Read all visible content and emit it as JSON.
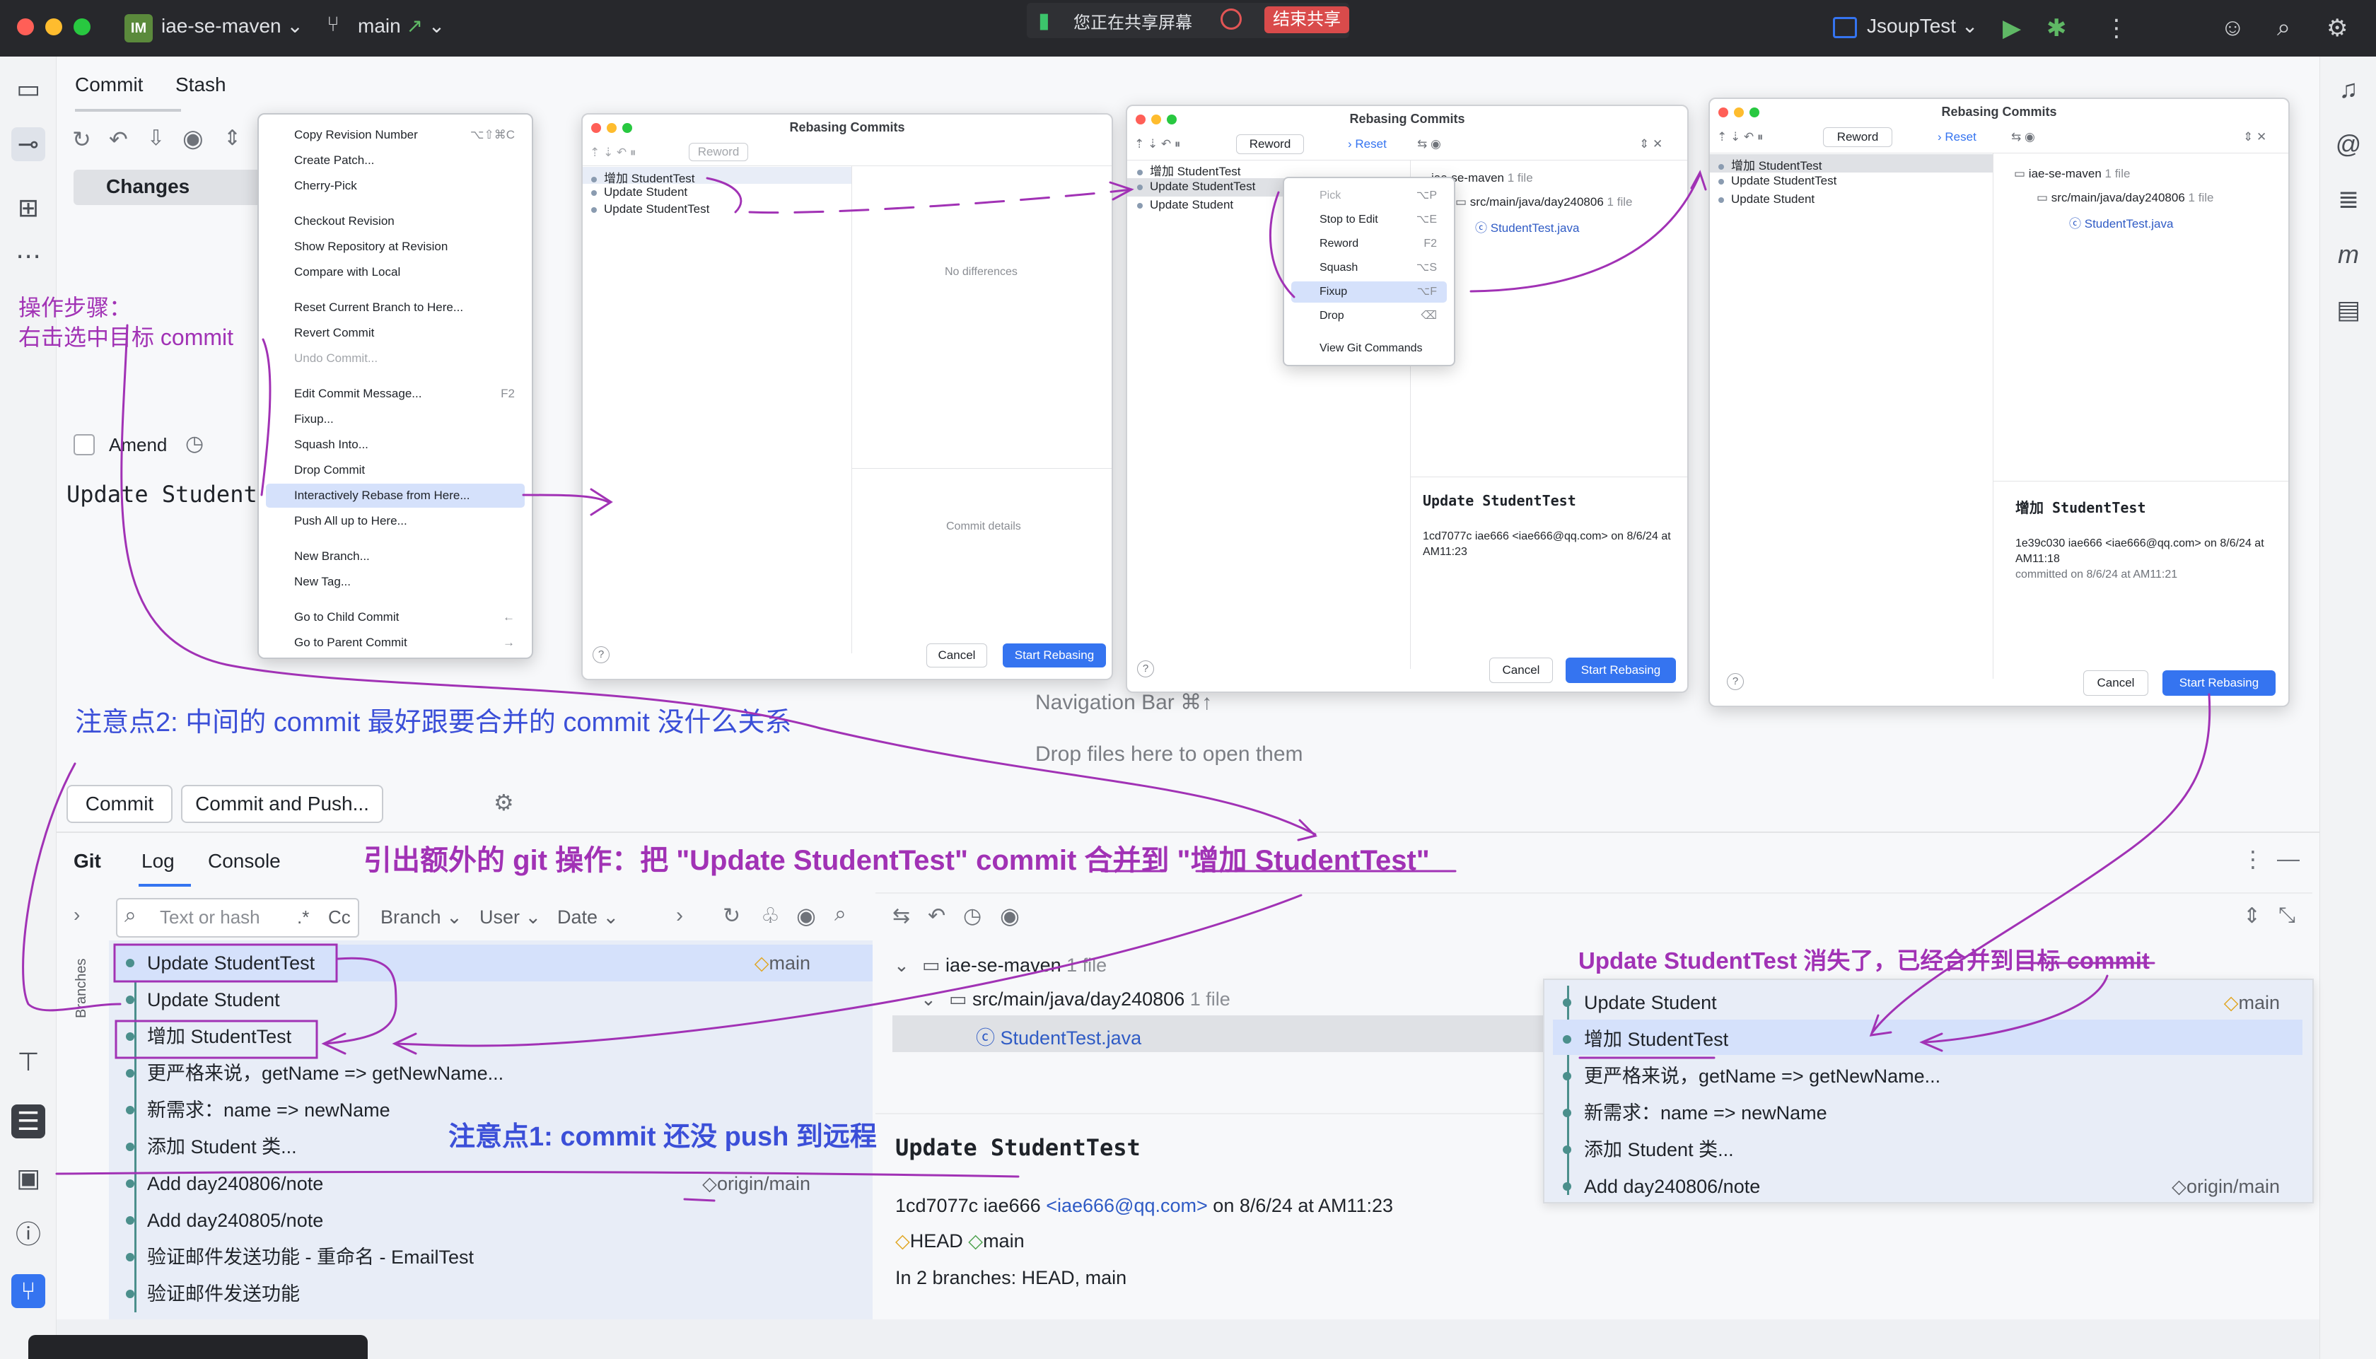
{
  "titlebar": {
    "project_badge": "IM",
    "project": "iae-se-maven",
    "branch": "main",
    "sharing_text": "您正在共享屏幕",
    "end_share": "结束共享",
    "run_config": "JsoupTest"
  },
  "commit_panel": {
    "tab_commit": "Commit",
    "tab_stash": "Stash",
    "changes_label": "Changes",
    "amend_label": "Amend",
    "message": "Update Student",
    "commit_button": "Commit",
    "commit_push_button": "Commit and Push..."
  },
  "editor_empty": {
    "nav_bar_hint": "Navigation Bar ⌘↑",
    "drop_hint": "Drop files here to open them"
  },
  "bottom_tabs": {
    "git": "Git",
    "log": "Log",
    "console": "Console"
  },
  "log_toolbar": {
    "search_placeholder": "Text or hash",
    "regex": ".*",
    "case": "Cc",
    "branch": "Branch",
    "user": "User",
    "date": "Date",
    "branches_side": "Branches"
  },
  "log_rows": [
    {
      "message": "Update StudentTest",
      "tag": "main"
    },
    {
      "message": "Update Student",
      "tag": ""
    },
    {
      "message": "增加 StudentTest",
      "tag": ""
    },
    {
      "message": "更严格来说，getName => getNewName...",
      "tag": ""
    },
    {
      "message": "新需求：name => newName",
      "tag": ""
    },
    {
      "message": "添加 Student 类...",
      "tag": ""
    },
    {
      "message": "Add day240806/note",
      "tag": "origin/main"
    },
    {
      "message": "Add day240805/note",
      "tag": ""
    },
    {
      "message": "验证邮件发送功能 - 重命名 - EmailTest",
      "tag": ""
    },
    {
      "message": "验证邮件发送功能",
      "tag": ""
    }
  ],
  "changes_tree": {
    "root": "iae-se-maven",
    "root_count": "1 file",
    "folder": "src/main/java/day240806",
    "folder_count": "1 file",
    "file": "StudentTest.java"
  },
  "commit_details": {
    "title": "Update StudentTest",
    "hash_author": "1cd7077c iae666",
    "email": "<iae666@qq.com>",
    "date": "on 8/6/24 at AM11:23",
    "ref_head": "HEAD",
    "ref_main": "main",
    "branches": "In 2 branches: HEAD, main"
  },
  "context_menu": [
    {
      "label": "Copy Revision Number",
      "shortcut": "⌥⇧⌘C",
      "disabled": false
    },
    {
      "label": "Create Patch...",
      "shortcut": "",
      "disabled": false
    },
    {
      "label": "Cherry-Pick",
      "shortcut": "",
      "disabled": false
    },
    {
      "label": "Checkout Revision",
      "shortcut": "",
      "disabled": false
    },
    {
      "label": "Show Repository at Revision",
      "shortcut": "",
      "disabled": false
    },
    {
      "label": "Compare with Local",
      "shortcut": "",
      "disabled": false
    },
    {
      "label": "Reset Current Branch to Here...",
      "shortcut": "",
      "disabled": false
    },
    {
      "label": "Revert Commit",
      "shortcut": "",
      "disabled": false
    },
    {
      "label": "Undo Commit...",
      "shortcut": "",
      "disabled": true
    },
    {
      "label": "Edit Commit Message...",
      "shortcut": "F2",
      "disabled": false
    },
    {
      "label": "Fixup...",
      "shortcut": "",
      "disabled": false
    },
    {
      "label": "Squash Into...",
      "shortcut": "",
      "disabled": false
    },
    {
      "label": "Drop Commit",
      "shortcut": "",
      "disabled": false
    },
    {
      "label": "Interactively Rebase from Here...",
      "shortcut": "",
      "disabled": false,
      "selected": true
    },
    {
      "label": "Push All up to Here...",
      "shortcut": "",
      "disabled": false
    },
    {
      "label": "New Branch...",
      "shortcut": "",
      "disabled": false
    },
    {
      "label": "New Tag...",
      "shortcut": "",
      "disabled": false
    },
    {
      "label": "Go to Child Commit",
      "shortcut": "←",
      "disabled": false
    },
    {
      "label": "Go to Parent Commit",
      "shortcut": "→",
      "disabled": false
    }
  ],
  "rebase_dialog_1": {
    "title": "Rebasing Commits",
    "reword": "Reword",
    "commits": [
      "增加 StudentTest",
      "Update Student",
      "Update StudentTest"
    ],
    "no_differences": "No differences",
    "commit_details": "Commit details",
    "cancel": "Cancel",
    "start": "Start Rebasing"
  },
  "rebase_dialog_2": {
    "title": "Rebasing Commits",
    "reword": "Reword",
    "reset": "Reset",
    "commits": [
      "增加 StudentTest",
      "Update StudentTest",
      "Update Student"
    ],
    "tree_root": "iae-se-maven",
    "tree_root_count": "1 file",
    "tree_folder": "src/main/java/day240806",
    "tree_folder_count": "1 file",
    "tree_file": "StudentTest.java",
    "popup": [
      {
        "label": "Pick",
        "shortcut": "⌥P"
      },
      {
        "label": "Stop to Edit",
        "shortcut": "⌥E"
      },
      {
        "label": "Reword",
        "shortcut": "F2"
      },
      {
        "label": "Squash",
        "shortcut": "⌥S"
      },
      {
        "label": "Fixup",
        "shortcut": "⌥F"
      },
      {
        "label": "Drop",
        "shortcut": "⌫"
      },
      {
        "label": "View Git Commands",
        "shortcut": ""
      }
    ],
    "detail_title": "Update StudentTest",
    "detail_meta": "1cd7077c iae666 <iae666@qq.com> on 8/6/24 at AM11:23",
    "cancel": "Cancel",
    "start": "Start Rebasing"
  },
  "rebase_dialog_3": {
    "title": "Rebasing Commits",
    "reword": "Reword",
    "reset": "Reset",
    "commits": [
      "增加 StudentTest",
      "Update StudentTest",
      "Update Student"
    ],
    "tree_root": "iae-se-maven",
    "tree_root_count": "1 file",
    "tree_folder": "src/main/java/day240806",
    "tree_folder_count": "1 file",
    "tree_file": "StudentTest.java",
    "detail_title": "增加 StudentTest",
    "detail_meta": "1e39c030 iae666 <iae666@qq.com> on 8/6/24 at AM11:18",
    "detail_committed": "committed on 8/6/24 at AM11:21",
    "cancel": "Cancel",
    "start": "Start Rebasing"
  },
  "result_log": [
    {
      "message": "Update Student",
      "tag": "main"
    },
    {
      "message": "增加 StudentTest",
      "tag": ""
    },
    {
      "message": "更严格来说，getName => getNewName...",
      "tag": ""
    },
    {
      "message": "新需求：name => newName",
      "tag": ""
    },
    {
      "message": "添加 Student 类...",
      "tag": ""
    },
    {
      "message": "Add day240806/note",
      "tag": "origin/main"
    }
  ],
  "annotations": {
    "steps_line1": "操作步骤：",
    "steps_line2": "右击选中目标 commit",
    "note2": "注意点2: 中间的 commit 最好跟要合并的 commit 没什么关系",
    "extra_op": "引出额外的 git 操作：把 \"Update StudentTest\" commit 合并到 \"增加 StudentTest\"",
    "note1": "注意点1: commit 还没 push 到远程",
    "result": "Update StudentTest 消失了，已经合并到目标 commit"
  },
  "colors": {
    "accent": "#3574f0",
    "annotation_purple": "#a132b5",
    "annotation_blue": "#3b4fd8",
    "graph_dot": "#4b8f8c"
  }
}
